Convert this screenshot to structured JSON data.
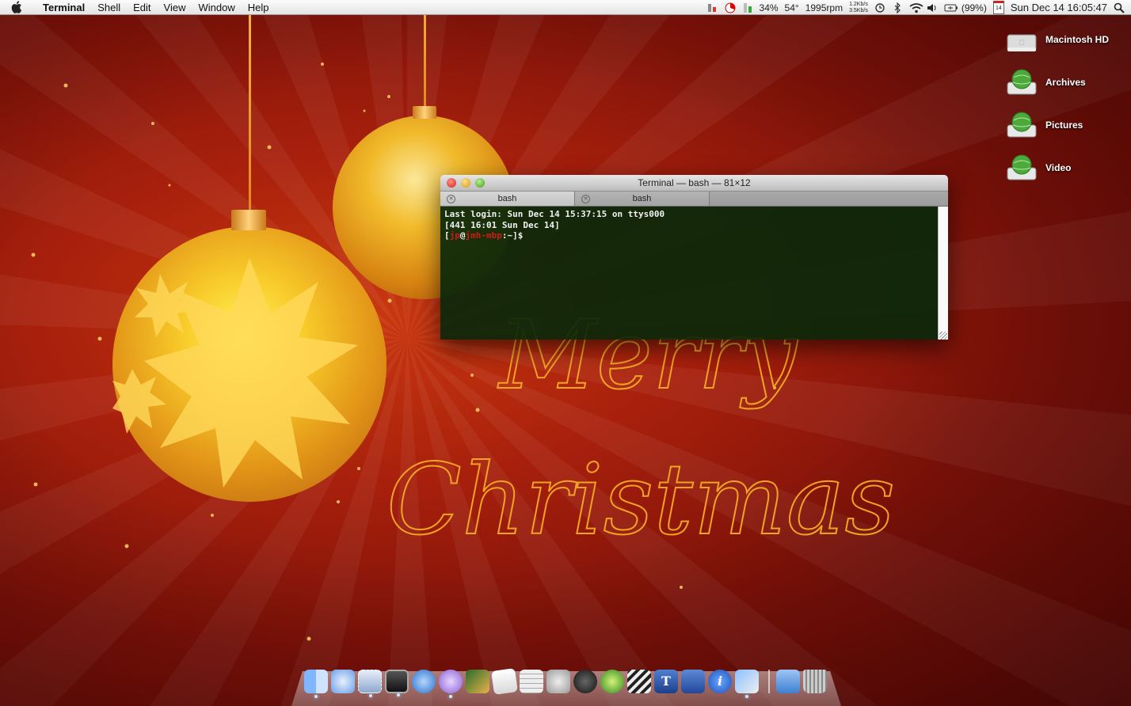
{
  "menubar": {
    "app_name": "Terminal",
    "menus": [
      "Shell",
      "Edit",
      "View",
      "Window",
      "Help"
    ],
    "status": {
      "cpu": "34%",
      "temp": "54°",
      "fan": "1995rpm",
      "net_up": "1.2Kb/s",
      "net_down": "3.5Kb/s",
      "battery": "(99%)",
      "calendar_day": "14",
      "clock": "Sun Dec 14 16:05:47"
    }
  },
  "desktop": {
    "drives": [
      {
        "label": "Macintosh HD"
      },
      {
        "label": "Archives"
      },
      {
        "label": "Pictures"
      },
      {
        "label": "Video"
      }
    ]
  },
  "terminal": {
    "title": "Terminal — bash — 81×12",
    "tabs": [
      {
        "label": "bash"
      },
      {
        "label": "bash"
      }
    ],
    "lines": [
      "Last login: Sun Dec 14 15:37:15 on ttys000",
      "[441 16:01 Sun Dec 14]"
    ],
    "prompt": {
      "open": "[",
      "user": "jp",
      "at": "@",
      "host": "jmh-mbp",
      "path": ":~]$"
    }
  },
  "colors": {
    "accent_red": "#d11a1a",
    "terminal_bg": "#0a280a",
    "wallpaper_red": "#a8200c",
    "ornament_gold": "#f0a324"
  }
}
